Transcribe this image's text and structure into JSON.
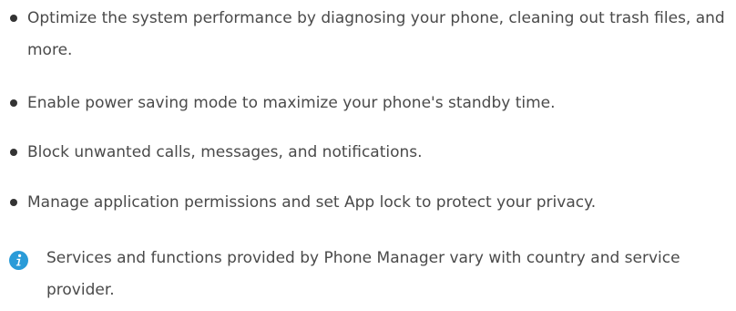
{
  "bullets": [
    "Optimize the system performance by diagnosing your phone, cleaning out trash files, and more.",
    "Enable power saving mode to maximize your phone's standby time.",
    "Block unwanted calls, messages, and notifications.",
    "Manage application permissions and set App lock to protect your privacy."
  ],
  "note": {
    "icon": "info-icon",
    "icon_color": "#2a9bd8",
    "text": "Services and functions provided by Phone Manager vary with country and service provider."
  }
}
